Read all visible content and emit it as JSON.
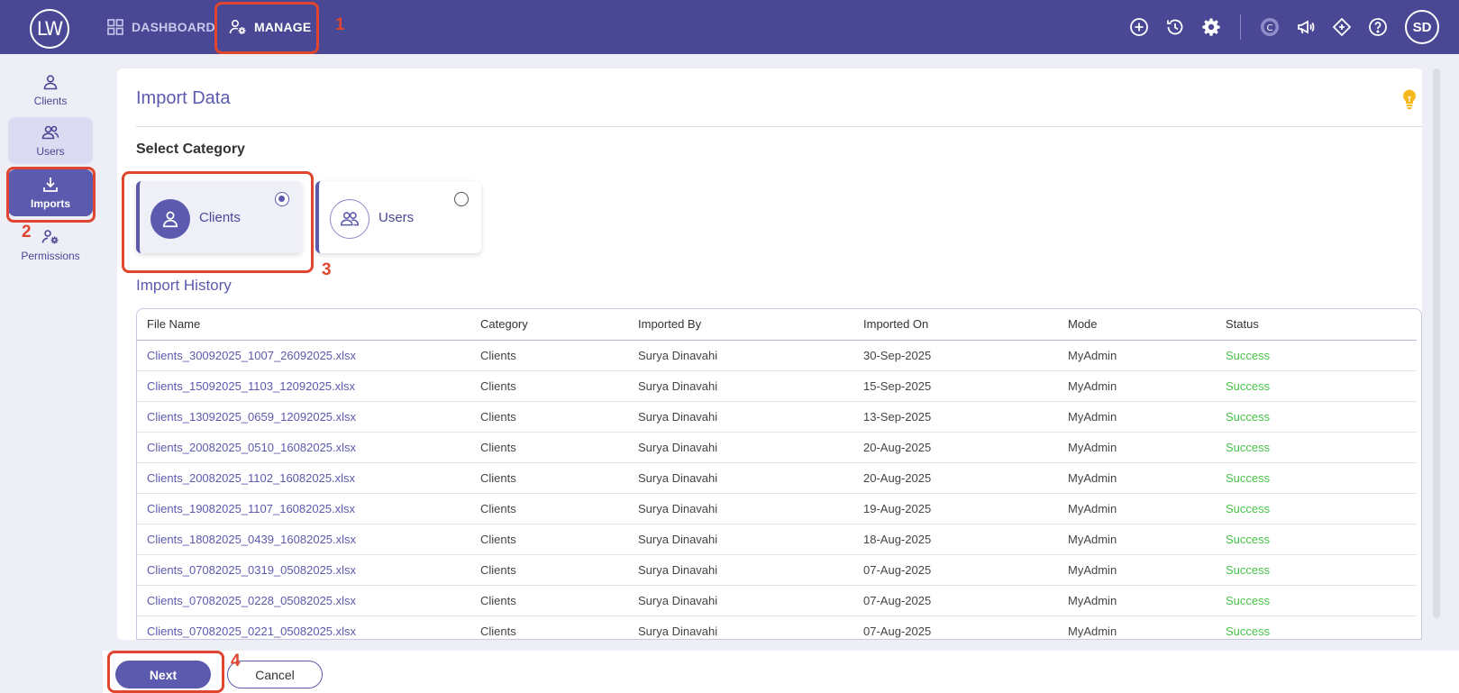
{
  "topbar": {
    "logo": "LW",
    "nav": [
      {
        "label": "DASHBOARD"
      },
      {
        "label": "MANAGE"
      }
    ],
    "avatar": "SD"
  },
  "sidebar": {
    "items": [
      {
        "label": "Clients"
      },
      {
        "label": "Users"
      },
      {
        "label": "Imports"
      },
      {
        "label": "Permissions"
      }
    ]
  },
  "page": {
    "title": "Import Data",
    "select_category_label": "Select Category",
    "categories": [
      {
        "label": "Clients",
        "selected": true
      },
      {
        "label": "Users",
        "selected": false
      }
    ],
    "history_label": "Import History"
  },
  "table": {
    "headers": [
      "File Name",
      "Category",
      "Imported By",
      "Imported On",
      "Mode",
      "Status"
    ],
    "rows": [
      [
        "Clients_30092025_1007_26092025.xlsx",
        "Clients",
        "Surya Dinavahi",
        "30-Sep-2025",
        "MyAdmin",
        "Success"
      ],
      [
        "Clients_15092025_1103_12092025.xlsx",
        "Clients",
        "Surya Dinavahi",
        "15-Sep-2025",
        "MyAdmin",
        "Success"
      ],
      [
        "Clients_13092025_0659_12092025.xlsx",
        "Clients",
        "Surya Dinavahi",
        "13-Sep-2025",
        "MyAdmin",
        "Success"
      ],
      [
        "Clients_20082025_0510_16082025.xlsx",
        "Clients",
        "Surya Dinavahi",
        "20-Aug-2025",
        "MyAdmin",
        "Success"
      ],
      [
        "Clients_20082025_1102_16082025.xlsx",
        "Clients",
        "Surya Dinavahi",
        "20-Aug-2025",
        "MyAdmin",
        "Success"
      ],
      [
        "Clients_19082025_1107_16082025.xlsx",
        "Clients",
        "Surya Dinavahi",
        "19-Aug-2025",
        "MyAdmin",
        "Success"
      ],
      [
        "Clients_18082025_0439_16082025.xlsx",
        "Clients",
        "Surya Dinavahi",
        "18-Aug-2025",
        "MyAdmin",
        "Success"
      ],
      [
        "Clients_07082025_0319_05082025.xlsx",
        "Clients",
        "Surya Dinavahi",
        "07-Aug-2025",
        "MyAdmin",
        "Success"
      ],
      [
        "Clients_07082025_0228_05082025.xlsx",
        "Clients",
        "Surya Dinavahi",
        "07-Aug-2025",
        "MyAdmin",
        "Success"
      ],
      [
        "Clients_07082025_0221_05082025.xlsx",
        "Clients",
        "Surya Dinavahi",
        "07-Aug-2025",
        "MyAdmin",
        "Success"
      ]
    ]
  },
  "footer": {
    "next_label": "Next",
    "cancel_label": "Cancel"
  },
  "annotations": [
    "1",
    "2",
    "3",
    "4"
  ],
  "colors": {
    "brand": "#4a4894",
    "accent": "#5c5aae",
    "success": "#49c249",
    "annotation": "#e0462f"
  },
  "icons": [
    "dashboard-icon",
    "manage-icon",
    "add-icon",
    "history-icon",
    "settings-icon",
    "c-icon",
    "announcement-icon",
    "diamond-icon",
    "help-icon",
    "bulb-icon"
  ]
}
